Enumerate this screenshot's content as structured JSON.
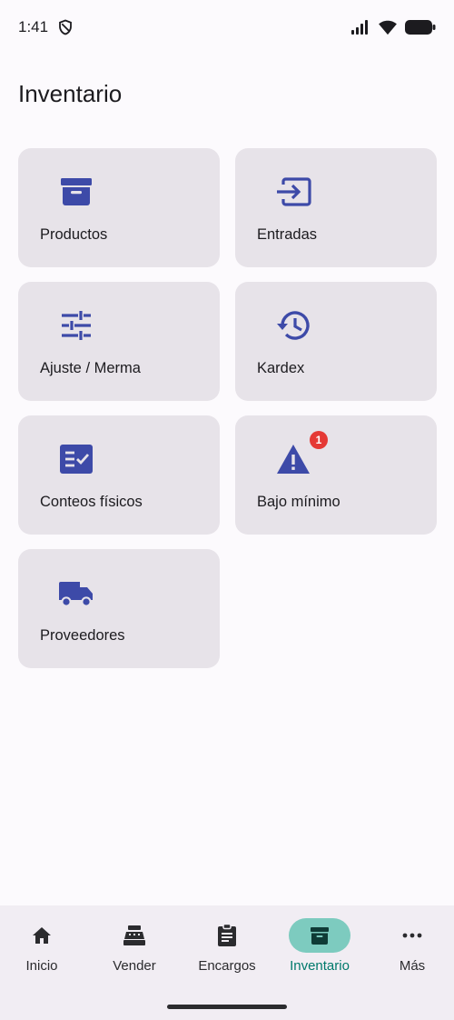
{
  "status_bar": {
    "time": "1:41",
    "icons": [
      "shield-icon",
      "signal-icon",
      "wifi-icon",
      "battery-icon"
    ]
  },
  "page": {
    "title": "Inventario"
  },
  "tiles": [
    {
      "label": "Productos",
      "icon": "archive-box-icon"
    },
    {
      "label": "Entradas",
      "icon": "input-arrow-icon"
    },
    {
      "label": "Ajuste / Merma",
      "icon": "sliders-icon"
    },
    {
      "label": "Kardex",
      "icon": "history-icon"
    },
    {
      "label": "Conteos físicos",
      "icon": "checklist-icon"
    },
    {
      "label": "Bajo mínimo",
      "icon": "warning-icon",
      "badge": "1"
    },
    {
      "label": "Proveedores",
      "icon": "truck-icon"
    }
  ],
  "bottom_nav": {
    "items": [
      {
        "label": "Inicio",
        "icon": "home-icon"
      },
      {
        "label": "Vender",
        "icon": "cash-register-icon"
      },
      {
        "label": "Encargos",
        "icon": "clipboard-icon"
      },
      {
        "label": "Inventario",
        "icon": "archive-box-icon",
        "active": true
      },
      {
        "label": "Más",
        "icon": "more-horizontal-icon"
      }
    ]
  },
  "colors": {
    "accent": "#3d4aa8",
    "active_nav": "#7dcbbf",
    "active_nav_text": "#00796b",
    "badge": "#e53935",
    "tile_bg": "#e7e3e9"
  }
}
